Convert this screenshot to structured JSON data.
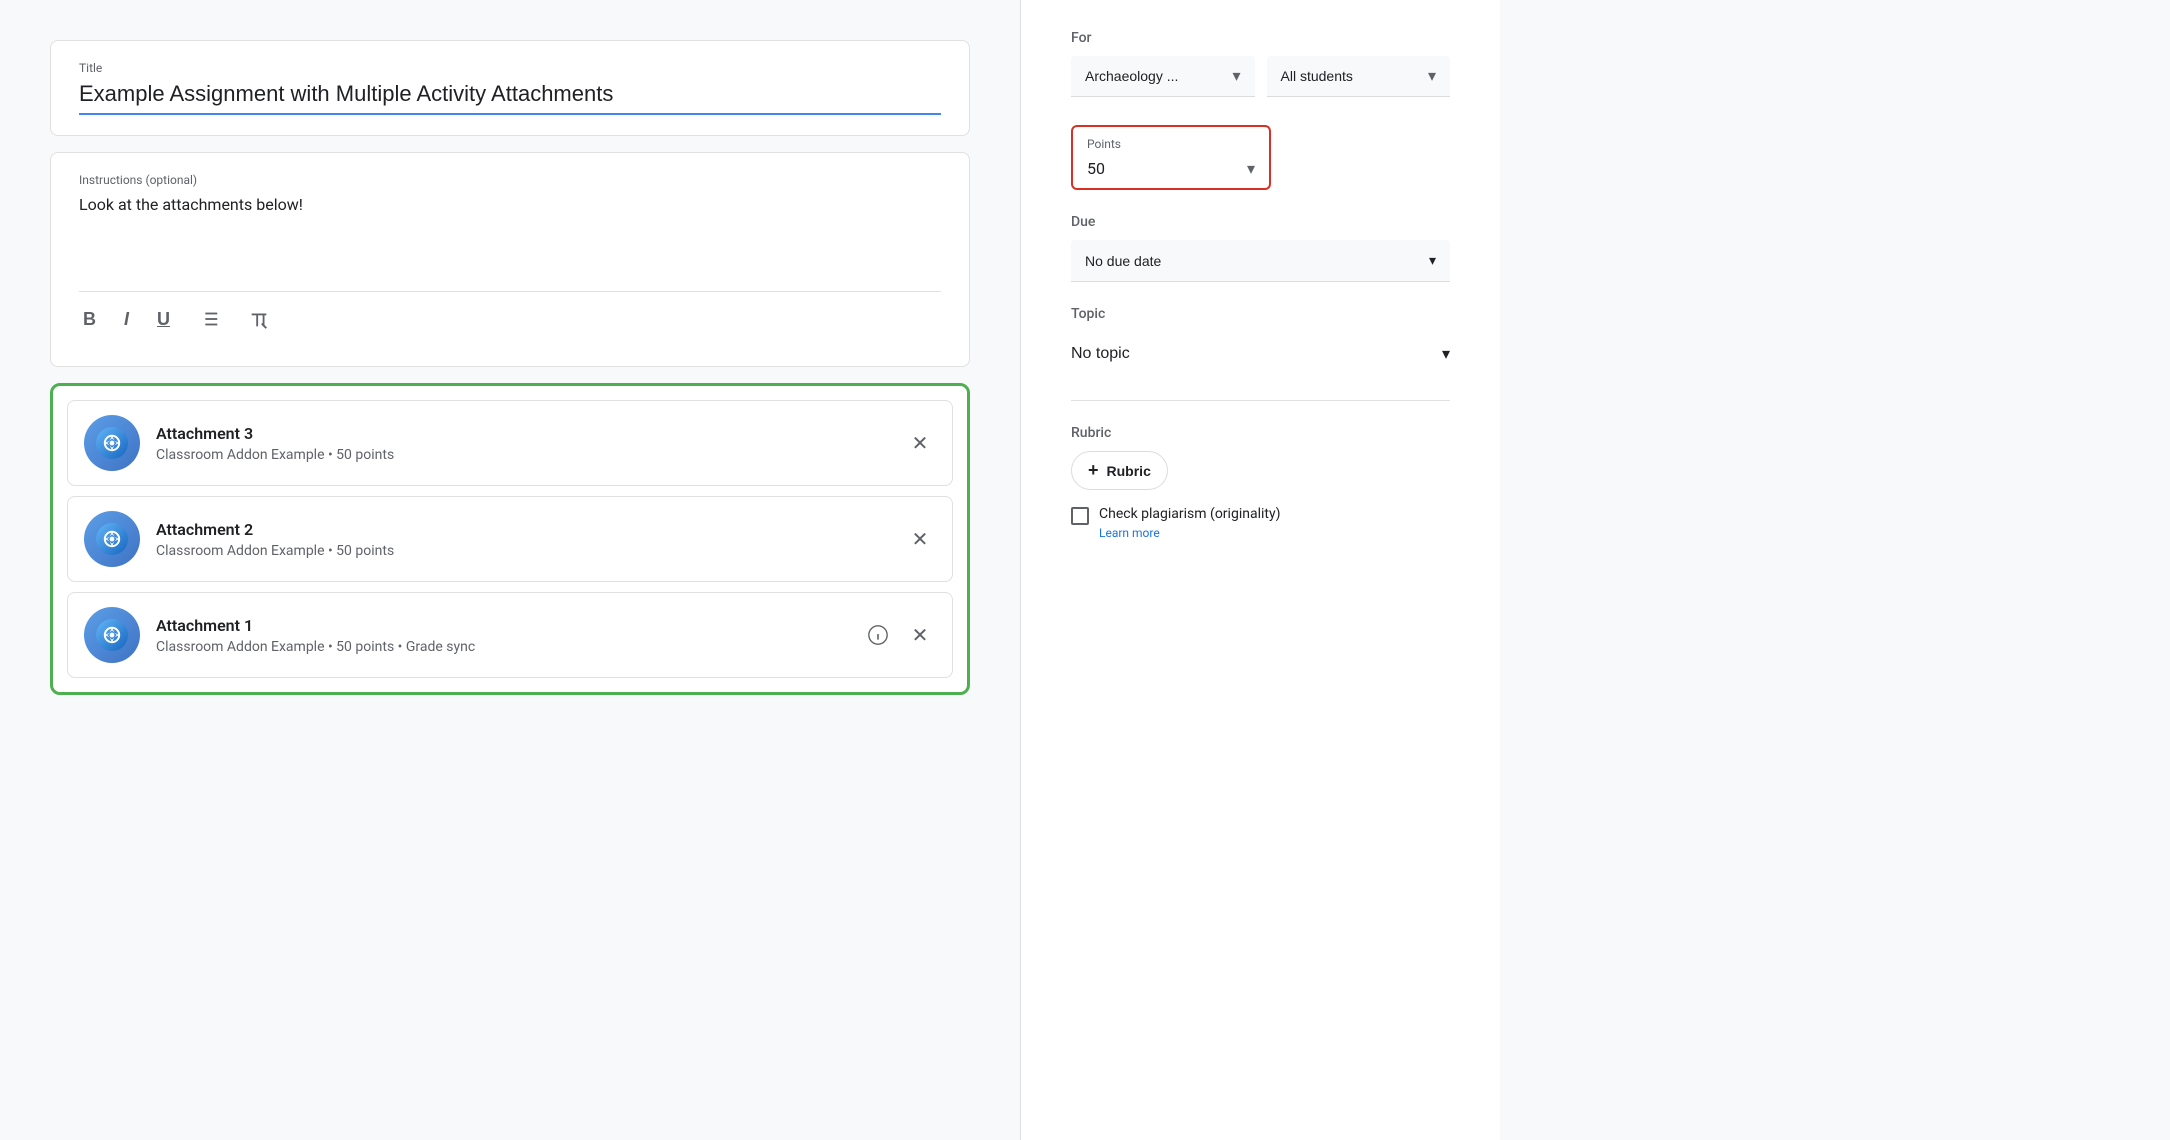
{
  "main": {
    "title_label": "Title",
    "title_value": "Example Assignment with Multiple Activity Attachments",
    "instructions_label": "Instructions (optional)",
    "instructions_value": "Look at the attachments below!",
    "toolbar": {
      "bold": "B",
      "italic": "I",
      "underline": "U",
      "list": "≡",
      "clear": "✕"
    },
    "attachments": [
      {
        "name": "Attachment 3",
        "meta": "Classroom Addon Example • 50 points",
        "has_info": false
      },
      {
        "name": "Attachment 2",
        "meta": "Classroom Addon Example • 50 points",
        "has_info": false
      },
      {
        "name": "Attachment 1",
        "meta": "Classroom Addon Example • 50 points • Grade sync",
        "has_info": true
      }
    ]
  },
  "sidebar": {
    "for_label": "For",
    "class_value": "Archaeology ...",
    "students_value": "All students",
    "points_label": "Points",
    "points_value": "50",
    "due_label": "Due",
    "due_value": "No due date",
    "topic_label": "Topic",
    "topic_value": "No topic",
    "rubric_label": "Rubric",
    "rubric_btn": "Rubric",
    "plagiarism_label": "Check plagiarism (originality)",
    "plagiarism_link": "Learn more"
  }
}
